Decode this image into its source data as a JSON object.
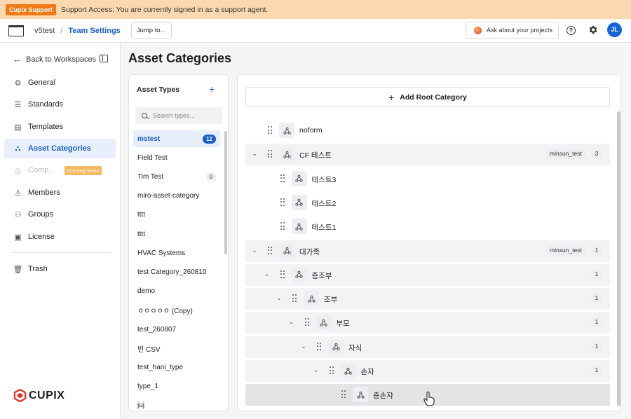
{
  "banner": {
    "badge": "Cupix Support",
    "message": "Support Access: You are currently signed in as a support agent."
  },
  "topnav": {
    "workspace": "v5test",
    "separator": "/",
    "current": "Team Settings",
    "jump_label": "Jump to...",
    "ask_label": "Ask about your projects",
    "help_glyph": "?",
    "avatar_initials": "JL"
  },
  "sidebar": {
    "back_label": "Back to Workspaces",
    "items": [
      {
        "label": "General",
        "icon": "gear-icon"
      },
      {
        "label": "Standards",
        "icon": "sliders-icon"
      },
      {
        "label": "Templates",
        "icon": "document-icon"
      },
      {
        "label": "Asset Categories",
        "icon": "asset-categories-icon",
        "active": true
      },
      {
        "label": "Compass",
        "icon": "compass-icon",
        "disabled": true,
        "badge": "Coming Soon"
      },
      {
        "label": "Members",
        "icon": "person-icon"
      },
      {
        "label": "Groups",
        "icon": "group-icon"
      },
      {
        "label": "License",
        "icon": "license-icon"
      },
      {
        "label": "Trash",
        "icon": "trash-icon"
      }
    ],
    "brand": "CUPIX"
  },
  "page": {
    "title": "Asset Categories"
  },
  "asset_types": {
    "heading": "Asset Types",
    "add_glyph": "+",
    "search_placeholder": "Search types...",
    "items": [
      {
        "label": "mstest",
        "count": "12",
        "active": true
      },
      {
        "label": "Field Test",
        "count": ""
      },
      {
        "label": "Tim Test",
        "count": "0"
      },
      {
        "label": "miro-asset-category",
        "count": ""
      },
      {
        "label": "tttt",
        "count": ""
      },
      {
        "label": "tttt",
        "count": ""
      },
      {
        "label": "HVAC Systems",
        "count": ""
      },
      {
        "label": "test Category_260810",
        "count": ""
      },
      {
        "label": "demo",
        "count": ""
      },
      {
        "label": "ㅇㅇㅇㅇㅇ (Copy)",
        "count": ""
      },
      {
        "label": "test_260807",
        "count": ""
      },
      {
        "label": "빈 CSV",
        "count": ""
      },
      {
        "label": "test_hani_type",
        "count": ""
      },
      {
        "label": "type_1",
        "count": ""
      },
      {
        "label": "juj",
        "count": ""
      }
    ]
  },
  "tree": {
    "add_root_label": "Add Root Category",
    "rows": [
      {
        "label": "noform",
        "depth": 0,
        "expandable": false,
        "tag": "",
        "count": ""
      },
      {
        "label": "CF 테스트",
        "depth": 0,
        "expandable": true,
        "tag": "minsun_test",
        "count": "3",
        "highlight": true
      },
      {
        "label": "테스트3",
        "depth": 1,
        "expandable": false,
        "tag": "",
        "count": ""
      },
      {
        "label": "테스트2",
        "depth": 1,
        "expandable": false,
        "tag": "",
        "count": ""
      },
      {
        "label": "테스트1",
        "depth": 1,
        "expandable": false,
        "tag": "",
        "count": ""
      },
      {
        "label": "대가족",
        "depth": 0,
        "expandable": true,
        "tag": "minsun_test",
        "count": "1",
        "highlight": true
      },
      {
        "label": "증조부",
        "depth": 1,
        "expandable": true,
        "tag": "",
        "count": "1",
        "highlight": true
      },
      {
        "label": "조부",
        "depth": 2,
        "expandable": true,
        "tag": "",
        "count": "1",
        "highlight": true
      },
      {
        "label": "부모",
        "depth": 3,
        "expandable": true,
        "tag": "",
        "count": "1",
        "highlight": true
      },
      {
        "label": "자식",
        "depth": 4,
        "expandable": true,
        "tag": "",
        "count": "1",
        "highlight": true
      },
      {
        "label": "손자",
        "depth": 5,
        "expandable": true,
        "tag": "",
        "count": "1",
        "highlight": true
      },
      {
        "label": "증손자",
        "depth": 6,
        "expandable": false,
        "tag": "",
        "count": "",
        "dragging": true
      }
    ]
  },
  "colors": {
    "accent": "#1a5fc7",
    "banner_bg": "#fbd9b0",
    "banner_badge": "#f07a17",
    "coming_soon": "#f5b962"
  }
}
